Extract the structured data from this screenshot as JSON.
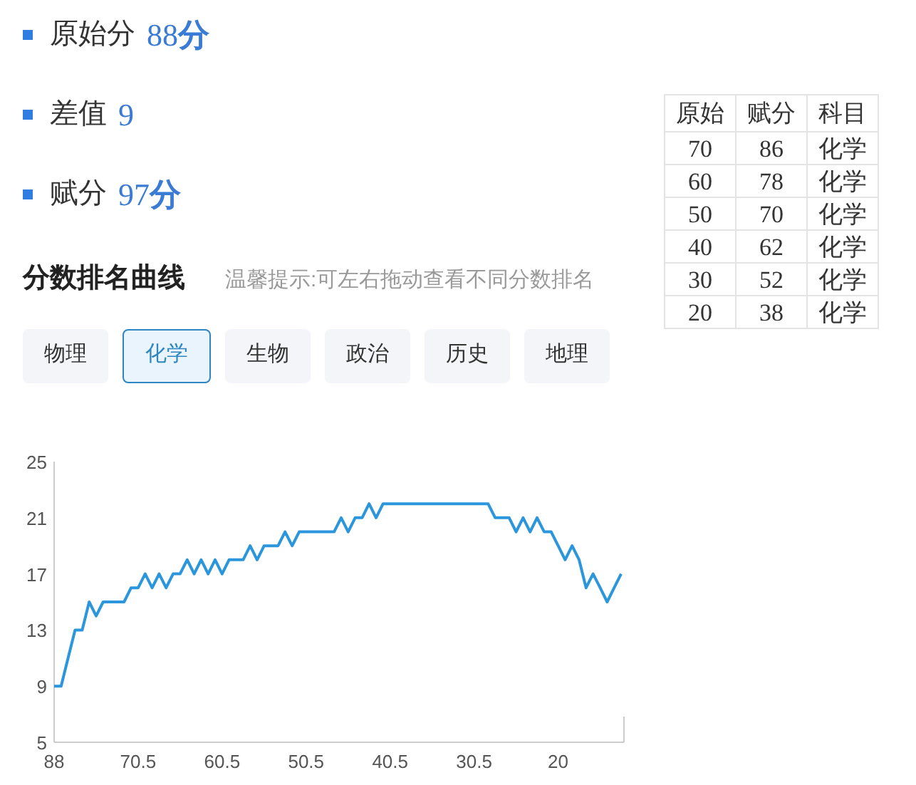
{
  "scores": [
    {
      "label": "原始分",
      "value": "88**分**"
    },
    {
      "label": "差值",
      "value": "9"
    },
    {
      "label": "赋分",
      "value": "97**分**"
    }
  ],
  "section": {
    "title": "分数排名曲线",
    "hint": "温馨提示:可左右拖动查看不同分数排名"
  },
  "tabs": [
    {
      "label": "物理",
      "selected": false
    },
    {
      "label": "化学",
      "selected": true
    },
    {
      "label": "生物",
      "selected": false
    },
    {
      "label": "政治",
      "selected": false
    },
    {
      "label": "历史",
      "selected": false
    },
    {
      "label": "地理",
      "selected": false
    }
  ],
  "table": {
    "columns": [
      "原始",
      "赋分",
      "科目"
    ],
    "rows": [
      [
        "70",
        "86",
        "化学"
      ],
      [
        "60",
        "78",
        "化学"
      ],
      [
        "50",
        "70",
        "化学"
      ],
      [
        "40",
        "62",
        "化学"
      ],
      [
        "30",
        "52",
        "化学"
      ],
      [
        "20",
        "38",
        "化学"
      ]
    ]
  },
  "chart_data": {
    "type": "line",
    "ylim": [
      5,
      25
    ],
    "yticks": [
      5,
      9,
      13,
      17,
      21,
      25
    ],
    "categories": [
      "88",
      null,
      null,
      null,
      null,
      null,
      null,
      null,
      null,
      null,
      null,
      null,
      "70.5",
      null,
      null,
      null,
      null,
      null,
      null,
      null,
      null,
      null,
      null,
      null,
      "60.5",
      null,
      null,
      null,
      null,
      null,
      null,
      null,
      null,
      null,
      null,
      null,
      "50.5",
      null,
      null,
      null,
      null,
      null,
      null,
      null,
      null,
      null,
      null,
      null,
      "40.5",
      null,
      null,
      null,
      null,
      null,
      null,
      null,
      null,
      null,
      null,
      null,
      "30.5",
      null,
      null,
      null,
      null,
      null,
      null,
      null,
      null,
      null,
      null,
      null,
      "20",
      null,
      null,
      null,
      null,
      null,
      null,
      null,
      null,
      null
    ],
    "series": [
      {
        "color": "#2b96db",
        "values": [
          9,
          9,
          11,
          13,
          13,
          15,
          14,
          15,
          15,
          15,
          15,
          16,
          16,
          17,
          16,
          17,
          16,
          17,
          17,
          18,
          17,
          18,
          17,
          18,
          17,
          18,
          18,
          18,
          19,
          18,
          19,
          19,
          19,
          20,
          19,
          20,
          20,
          20,
          20,
          20,
          20,
          21,
          20,
          21,
          21,
          22,
          21,
          22,
          22,
          22,
          22,
          22,
          22,
          22,
          22,
          22,
          22,
          22,
          22,
          22,
          22,
          22,
          22,
          21,
          21,
          21,
          20,
          21,
          20,
          21,
          20,
          20,
          19,
          18,
          19,
          18,
          16,
          17,
          16,
          15,
          16,
          17
        ]
      }
    ]
  }
}
